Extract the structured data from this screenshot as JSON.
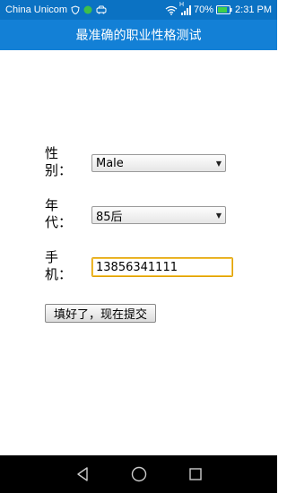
{
  "status_bar": {
    "carrier": "China Unicom",
    "battery": "70%",
    "time": "2:31 PM",
    "network": "H"
  },
  "app_bar": {
    "title": "最准确的职业性格测试"
  },
  "form": {
    "gender": {
      "label": "性\n别：",
      "value": "Male"
    },
    "generation": {
      "label": "年\n代：",
      "value": "85后"
    },
    "phone": {
      "label": "手\n机：",
      "value": "13856341111"
    },
    "submit_label": "填好了，现在提交"
  },
  "colors": {
    "status_bar_bg": "#0b72c3",
    "app_bar_bg": "#1380d6",
    "input_focus_border": "#e0a000"
  },
  "icons": [
    "shield-icon",
    "wechat-icon",
    "car-icon",
    "wifi-icon",
    "signal-icon",
    "battery-icon",
    "back-icon",
    "home-icon",
    "recents-icon"
  ]
}
